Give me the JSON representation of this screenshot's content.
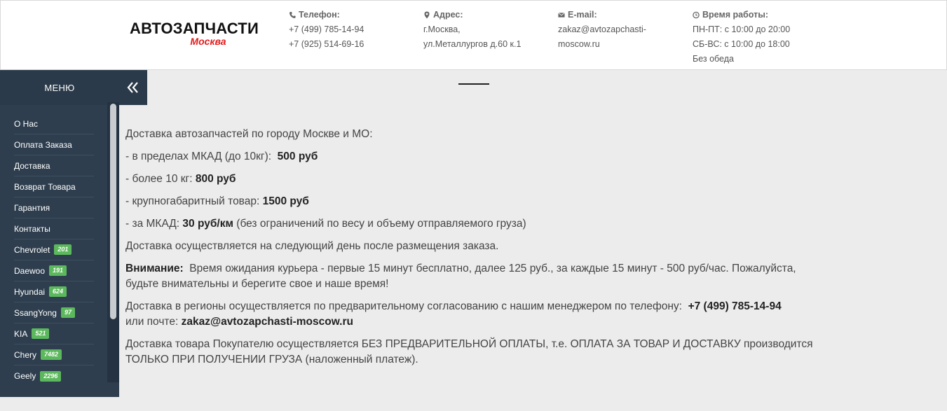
{
  "header": {
    "logo_title": "АВТОЗАПЧАСТИ",
    "logo_subtitle": "Москва",
    "phone": {
      "title": "Телефон:",
      "line1": "+7 (499) 785-14-94",
      "line2": "+7 (925) 514-69-16"
    },
    "address": {
      "title": "Адрес:",
      "line1": "г.Москва,",
      "line2": "ул.Металлургов д.60 к.1"
    },
    "email": {
      "title": "E-mail:",
      "line1": "zakaz@avtozapchasti-",
      "line2": "moscow.ru"
    },
    "hours": {
      "title": "Время работы:",
      "line1": "ПН-ПТ: с 10:00 до 20:00",
      "line2": "СБ-ВС: с 10:00 до 18:00",
      "line3": "Без обеда"
    }
  },
  "sidebar": {
    "menu_title": "МЕНЮ",
    "items": [
      {
        "label": "О Нас"
      },
      {
        "label": "Оплата Заказа"
      },
      {
        "label": "Доставка"
      },
      {
        "label": "Возврат Товара"
      },
      {
        "label": "Гарантия"
      },
      {
        "label": "Контакты"
      },
      {
        "label": "Chevrolet",
        "badge": "201"
      },
      {
        "label": "Daewoo",
        "badge": "191"
      },
      {
        "label": "Hyundai",
        "badge": "624"
      },
      {
        "label": "SsangYong",
        "badge": "97"
      },
      {
        "label": "KIA",
        "badge": "521"
      },
      {
        "label": "Chery",
        "badge": "7482"
      },
      {
        "label": "Geely",
        "badge": "2296"
      }
    ]
  },
  "content": {
    "p1": "Доставка автозапчастей по городу Москве и МО:",
    "p2_text": "- в пределах МКАД (до 10кг):",
    "p2_bold": "500 руб",
    "p3_text": "- более 10 кг:",
    "p3_bold": "800 руб",
    "p4_text": "- крупногабаритный товар:",
    "p4_bold": "1500 руб",
    "p5_text": "- за МКАД:",
    "p5_bold": "30 руб/км",
    "p5_tail": "(без ограничений по весу и объему отправляемого груза)",
    "p6": "Доставка осуществляется на следующий день после размещения заказа.",
    "p7_bold": "Внимание:",
    "p7_text": "Время ожидания курьера - первые 15 минут бесплатно, далее 125 руб., за каждые 15 минут - 500 руб/час. Пожалуйста, будьте внимательны и берегите свое и наше время!",
    "p8_text": "Доставка в регионы осуществляется по предварительному согласованию с нашим менеджером по телефону:",
    "p8_phone": "+7 (499) 785-14-94",
    "p8_text2": "или почте:",
    "p8_email": "zakaz@avtozapchasti-moscow.ru",
    "p9": "Доставка товара Покупателю осуществляется БЕЗ ПРЕДВАРИТЕЛЬНОЙ ОПЛАТЫ, т.е. ОПЛАТА ЗА ТОВАР И ДОСТАВКУ производится ТОЛЬКО ПРИ ПОЛУЧЕНИИ ГРУЗА (наложенный платеж)."
  },
  "colors": {
    "sidebar": "#2e3e4e",
    "badge": "#5cb85c",
    "logo_accent": "#e21b1b"
  }
}
